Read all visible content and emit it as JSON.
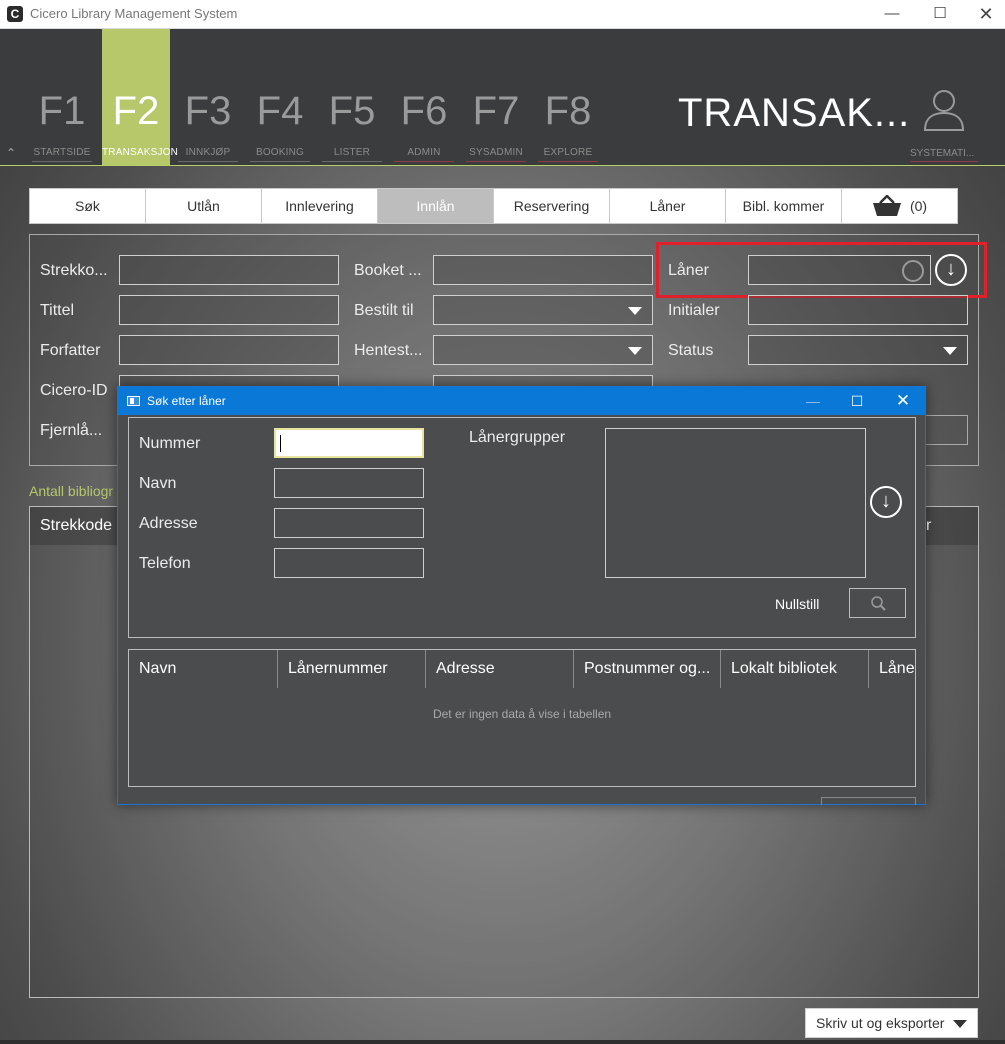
{
  "window": {
    "title": "Cicero Library Management System",
    "logo_letter": "C"
  },
  "fkeys": [
    {
      "num": "F1",
      "label": "STARTSIDE"
    },
    {
      "num": "F2",
      "label": "TRANSAKSJON"
    },
    {
      "num": "F3",
      "label": "INNKJØP"
    },
    {
      "num": "F4",
      "label": "BOOKING"
    },
    {
      "num": "F5",
      "label": "LISTER"
    },
    {
      "num": "F6",
      "label": "ADMIN"
    },
    {
      "num": "F7",
      "label": "SYSADMIN"
    },
    {
      "num": "F8",
      "label": "EXPLORE"
    }
  ],
  "header": {
    "section_title": "TRANSAK...",
    "user_label": "SYSTEMATI...",
    "accent": "#b6c86a"
  },
  "subtabs": [
    "Søk",
    "Utlån",
    "Innlevering",
    "Innlån",
    "Reservering",
    "Låner",
    "Bibl. kommer"
  ],
  "basket": {
    "count": "(0)"
  },
  "search_form": {
    "strekkode": "Strekko...",
    "tittel": "Tittel",
    "forfatter": "Forfatter",
    "cicero_id": "Cicero-ID",
    "fjernlan": "Fjernlå...",
    "booket": "Booket ...",
    "bestilt_til": "Bestilt til",
    "hentested": "Hentest...",
    "laner": "Låner",
    "initialer": "Initialer",
    "status": "Status"
  },
  "count_label": "Antall bibliogr",
  "results": {
    "col_strekkode": "Strekkode",
    "col_right_fragment": "r"
  },
  "export_button": "Skriv ut og eksporter",
  "dialog": {
    "title": "Søk etter låner",
    "nummer": "Nummer",
    "navn": "Navn",
    "adresse": "Adresse",
    "telefon": "Telefon",
    "lanergrupper": "Lånergrupper",
    "reset": "Nullstill",
    "table_headers": [
      "Navn",
      "Lånernummer",
      "Adresse",
      "Postnummer og...",
      "Lokalt bibliotek",
      "Låner"
    ],
    "empty_message": "Det er ingen data å vise i tabellen"
  }
}
